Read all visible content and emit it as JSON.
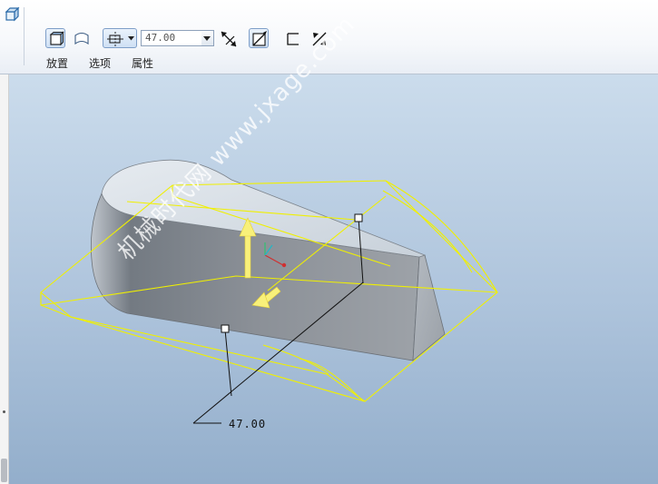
{
  "toolbar": {
    "depth_value": "47.00",
    "tabs": [
      {
        "label": "放置"
      },
      {
        "label": "选项"
      },
      {
        "label": "属性"
      }
    ]
  },
  "viewport": {
    "dimension_label": "47.00",
    "watermark": "机械时代网 www.jxage.com"
  },
  "colors": {
    "preview_outline": "#f0f000",
    "viewport_top": "#cbdcec",
    "viewport_bottom": "#93aecb",
    "drag_arrow": "#f8f07a"
  }
}
